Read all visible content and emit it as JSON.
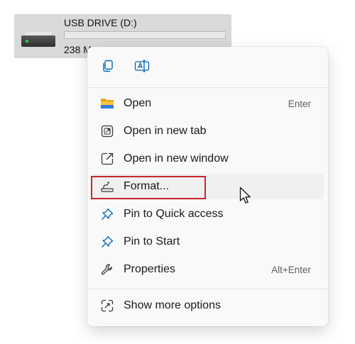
{
  "drive": {
    "name": "USB DRIVE (D:)",
    "size_text": "238 M",
    "usage_fraction": 0.0
  },
  "quick_actions": [
    {
      "name": "copy",
      "icon": "copy-icon"
    },
    {
      "name": "rename",
      "icon": "rename-icon"
    }
  ],
  "menu": {
    "items": [
      {
        "label": "Open",
        "shortcut": "Enter",
        "icon": "folder-icon"
      },
      {
        "label": "Open in new tab",
        "shortcut": "",
        "icon": "open-in-new-tab-icon"
      },
      {
        "label": "Open in new window",
        "shortcut": "",
        "icon": "open-in-new-window-icon"
      },
      {
        "label": "Format...",
        "shortcut": "",
        "icon": "format-icon"
      },
      {
        "label": "Pin to Quick access",
        "shortcut": "",
        "icon": "pin-icon"
      },
      {
        "label": "Pin to Start",
        "shortcut": "",
        "icon": "pin-icon"
      },
      {
        "label": "Properties",
        "shortcut": "Alt+Enter",
        "icon": "wrench-icon"
      },
      {
        "label": "Show more options",
        "shortcut": "",
        "icon": "show-more-options-icon"
      }
    ]
  },
  "colors": {
    "accent": "#0067c0",
    "highlight_border": "#c8262c",
    "folder_yellow": "#f8c43a"
  }
}
